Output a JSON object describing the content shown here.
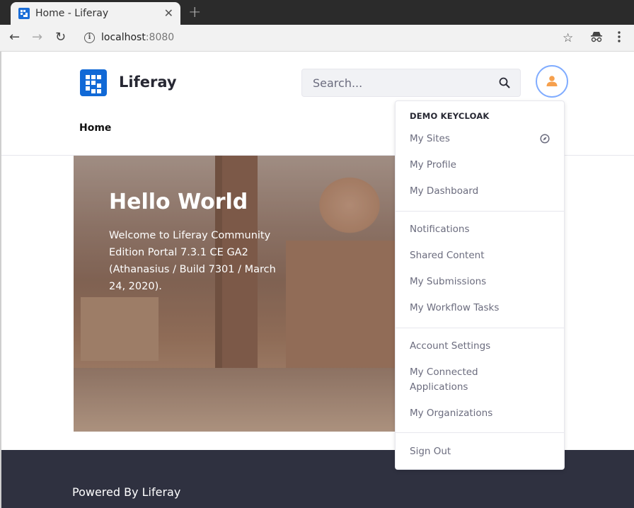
{
  "browser": {
    "tab_title": "Home - Liferay",
    "url_host": "localhost",
    "url_port": ":8080",
    "icons": [
      "back-arrow-icon",
      "forward-arrow-icon",
      "reload-icon",
      "info-icon",
      "star-icon",
      "incognito-icon",
      "menu-dots-icon"
    ]
  },
  "header": {
    "site_name": "Liferay",
    "search_placeholder": "Search...",
    "nav": [
      {
        "label": "Home"
      }
    ]
  },
  "hero": {
    "title": "Hello World",
    "text": "Welcome to Liferay Community Edition Portal 7.3.1 CE GA2 (Athanasius / Build 7301 / March 24, 2020)."
  },
  "user_menu": {
    "header": "DEMO KEYCLOAK",
    "groups": [
      [
        {
          "label": "My Sites",
          "icon": "compass-icon"
        },
        {
          "label": "My Profile"
        },
        {
          "label": "My Dashboard"
        }
      ],
      [
        {
          "label": "Notifications"
        },
        {
          "label": "Shared Content"
        },
        {
          "label": "My Submissions"
        },
        {
          "label": "My Workflow Tasks"
        }
      ],
      [
        {
          "label": "Account Settings"
        },
        {
          "label": "My Connected Applications"
        },
        {
          "label": "My Organizations"
        }
      ],
      [
        {
          "label": "Sign Out"
        }
      ]
    ]
  },
  "footer": {
    "text": "Powered By Liferay"
  },
  "colors": {
    "brand_blue": "#1169d6",
    "avatar_ring": "#80acff",
    "avatar_icon": "#f6a04d",
    "footer_bg": "#2f3140",
    "menu_text": "#6b6c7e"
  }
}
